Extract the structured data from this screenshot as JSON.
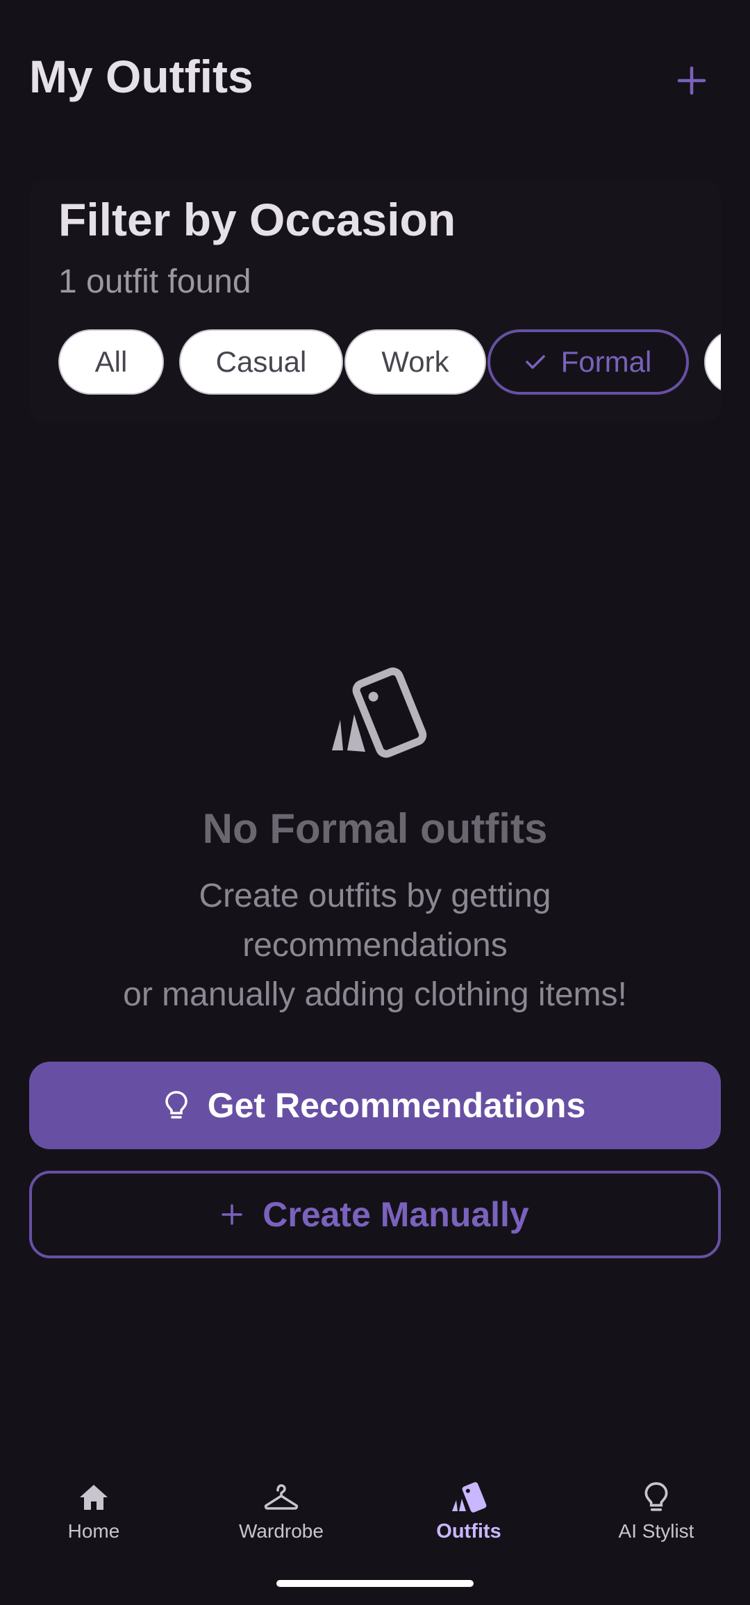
{
  "header": {
    "title": "My Outfits",
    "add_icon": "plus-icon"
  },
  "filter": {
    "title": "Filter by Occasion",
    "count": "1 outfit found",
    "chips": [
      {
        "label": "All",
        "selected": false
      },
      {
        "label": "Casual",
        "selected": false
      },
      {
        "label": "Work",
        "selected": false
      },
      {
        "label": "Formal",
        "selected": true
      }
    ]
  },
  "empty_state": {
    "icon": "outfit-cards-icon",
    "title": "No Formal outfits",
    "line1": "Create outfits by getting",
    "line2": "recommendations",
    "line3": "or manually adding clothing items!"
  },
  "actions": {
    "primary_label": "Get Recommendations",
    "primary_icon": "lightbulb-icon",
    "secondary_label": "Create Manually",
    "secondary_icon": "plus-icon"
  },
  "nav": {
    "items": [
      {
        "label": "Home",
        "icon": "home-icon",
        "active": false
      },
      {
        "label": "Wardrobe",
        "icon": "hanger-icon",
        "active": false
      },
      {
        "label": "Outfits",
        "icon": "outfit-cards-icon",
        "active": true
      },
      {
        "label": "AI Stylist",
        "icon": "lightbulb-icon",
        "active": false
      }
    ]
  },
  "colors": {
    "background": "#141218",
    "accent": "#6750a4",
    "accent_text": "#7a62bd",
    "nav_active": "#c9b7ff"
  }
}
